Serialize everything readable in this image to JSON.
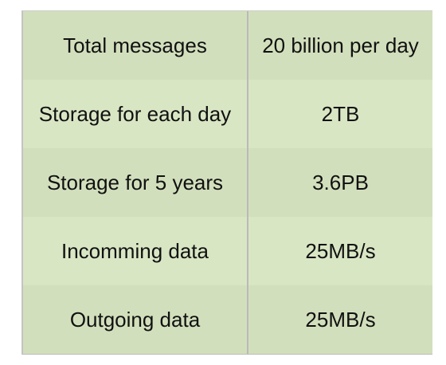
{
  "table": {
    "rows": [
      {
        "label": "Total messages",
        "value": "20 billion per day"
      },
      {
        "label": "Storage for each day",
        "value": "2TB"
      },
      {
        "label": "Storage for 5 years",
        "value": "3.6PB"
      },
      {
        "label": "Incomming data",
        "value": "25MB/s"
      },
      {
        "label": "Outgoing data",
        "value": "25MB/s"
      }
    ]
  }
}
